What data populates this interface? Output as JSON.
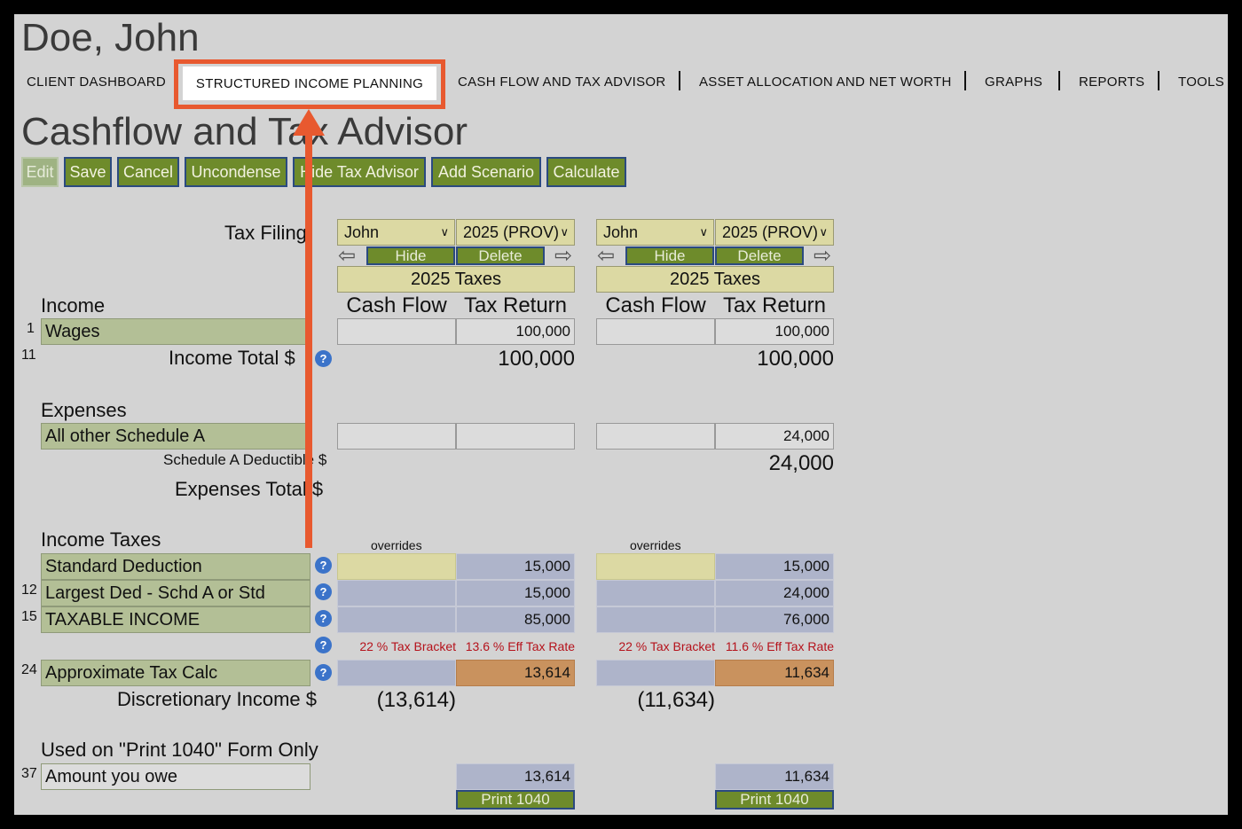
{
  "client_name": "Doe, John",
  "nav": {
    "items": [
      "CLIENT DASHBOARD",
      "STRUCTURED INCOME PLANNING",
      "CASH FLOW AND TAX ADVISOR",
      "ASSET ALLOCATION AND NET WORTH",
      "GRAPHS",
      "REPORTS",
      "TOOLS"
    ],
    "active": "STRUCTURED INCOME PLANNING",
    "highlight_color": "#e8592f"
  },
  "page_title": "Cashflow and Tax Advisor",
  "toolbar": {
    "edit": "Edit",
    "save": "Save",
    "cancel": "Cancel",
    "uncondense": "Uncondense",
    "hide_tax_advisor": "Hide Tax Advisor",
    "add_scenario": "Add Scenario",
    "calculate": "Calculate"
  },
  "tax_filing_label": "Tax Filing",
  "scenarios": [
    {
      "person": "John",
      "year": "2025 (PROV)",
      "hide": "Hide",
      "delete": "Delete",
      "taxes_label": "2025 Taxes",
      "col_cash_flow": "Cash Flow",
      "col_tax_return": "Tax Return",
      "wages": "100,000",
      "income_total": "100,000",
      "schedule_a_cash": "",
      "schedule_a_tax": "",
      "schedule_a_deductible": "",
      "overrides": "overrides",
      "standard_deduction": "15,000",
      "largest_ded": "15,000",
      "taxable_income": "85,000",
      "tax_bracket": "22 % Tax Bracket",
      "eff_tax_rate": "13.6 % Eff Tax Rate",
      "approx_tax": "13,614",
      "discretionary": "(13,614)",
      "amount_owe": "13,614",
      "print": "Print 1040"
    },
    {
      "person": "John",
      "year": "2025 (PROV)",
      "hide": "Hide",
      "delete": "Delete",
      "taxes_label": "2025 Taxes",
      "col_cash_flow": "Cash Flow",
      "col_tax_return": "Tax Return",
      "wages": "100,000",
      "income_total": "100,000",
      "schedule_a_cash": "",
      "schedule_a_tax": "24,000",
      "schedule_a_deductible": "24,000",
      "overrides": "overrides",
      "standard_deduction": "15,000",
      "largest_ded": "24,000",
      "taxable_income": "76,000",
      "tax_bracket": "22 % Tax Bracket",
      "eff_tax_rate": "11.6 % Eff Tax Rate",
      "approx_tax": "11,634",
      "discretionary": "(11,634)",
      "amount_owe": "11,634",
      "print": "Print 1040"
    }
  ],
  "sections": {
    "income": "Income",
    "expenses": "Expenses",
    "income_taxes": "Income Taxes",
    "print_only": "Used on \"Print 1040\" Form Only"
  },
  "rows": {
    "wages": {
      "num": "1",
      "label": "Wages"
    },
    "income_total": {
      "num": "11",
      "label": "Income Total $"
    },
    "schedule_a": {
      "label": "All other Schedule A"
    },
    "schedule_a_deductible": {
      "label": "Schedule A Deductible $"
    },
    "expenses_total": {
      "label": "Expenses Total $"
    },
    "standard_deduction": {
      "label": "Standard Deduction"
    },
    "largest_ded": {
      "num": "12",
      "label": "Largest Ded - Schd A or Std"
    },
    "taxable_income": {
      "num": "15",
      "label": "TAXABLE INCOME"
    },
    "approx_tax": {
      "num": "24",
      "label": "Approximate Tax Calc"
    },
    "discretionary": {
      "label": "Discretionary Income $"
    },
    "amount_owe": {
      "num": "37",
      "label": "Amount you owe"
    }
  },
  "help_glyph": "?",
  "icons": {
    "help": "question-circle-icon",
    "prev": "arrow-left-icon",
    "next": "arrow-right-icon",
    "dropdown": "chevron-down-icon"
  }
}
